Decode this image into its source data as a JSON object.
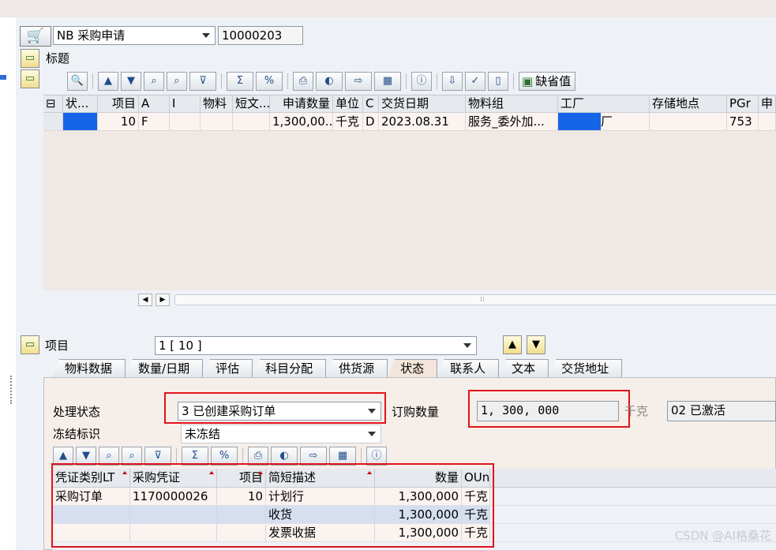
{
  "header": {
    "doc_type": "NB 采购申请",
    "doc_number": "10000203",
    "title_label": "标题"
  },
  "toolbar_top": {
    "default_values_label": "缺省值"
  },
  "items_grid": {
    "columns": [
      "状...",
      "项目",
      "A",
      "I",
      "物料",
      "短文...",
      "申请数量",
      "单位",
      "C",
      "交货日期",
      "物料组",
      "工厂",
      "存储地点",
      "PGr",
      "申"
    ],
    "row": {
      "status": "",
      "item": "10",
      "a": "F",
      "i": "",
      "material": "",
      "short_text": "",
      "quantity": "1,300,00...",
      "unit": "千克",
      "c": "D",
      "delivery_date": "2023.08.31",
      "material_group": "服务_委外加...",
      "plant": "厂",
      "storage": "",
      "pgr": "753",
      "extra": ""
    }
  },
  "item_section": {
    "label": "项目",
    "selector": "1 [ 10 ]"
  },
  "tabs": [
    "物料数据",
    "数量/日期",
    "评估",
    "科目分配",
    "供货源",
    "状态",
    "联系人",
    "文本",
    "交货地址"
  ],
  "status_tab": {
    "processing_status_label": "处理状态",
    "processing_status_value": "3 已创建采购订单",
    "order_qty_label": "订购数量",
    "order_qty_value": "1, 300, 000",
    "order_qty_unit": "千克",
    "activation_value": "02 已激活",
    "freeze_label": "冻结标识",
    "freeze_value": "未冻结"
  },
  "history_grid": {
    "columns": [
      "凭证类别LT",
      "采购凭证",
      "项目",
      "简短描述",
      "数量",
      "OUn"
    ],
    "rows": [
      {
        "type": "采购订单",
        "doc": "1170000026",
        "item": "10",
        "desc": "计划行",
        "qty": "1,300,000",
        "unit": "千克"
      },
      {
        "type": "",
        "doc": "",
        "item": "",
        "desc": "收货",
        "qty": "1,300,000",
        "unit": "千克"
      },
      {
        "type": "",
        "doc": "",
        "item": "",
        "desc": "发票收据",
        "qty": "1,300,000",
        "unit": "千克"
      }
    ]
  },
  "watermark": "CSDN @AI格桑花",
  "colors": {
    "highlight_red": "#e0141a",
    "selection_blue": "#1565e6"
  }
}
